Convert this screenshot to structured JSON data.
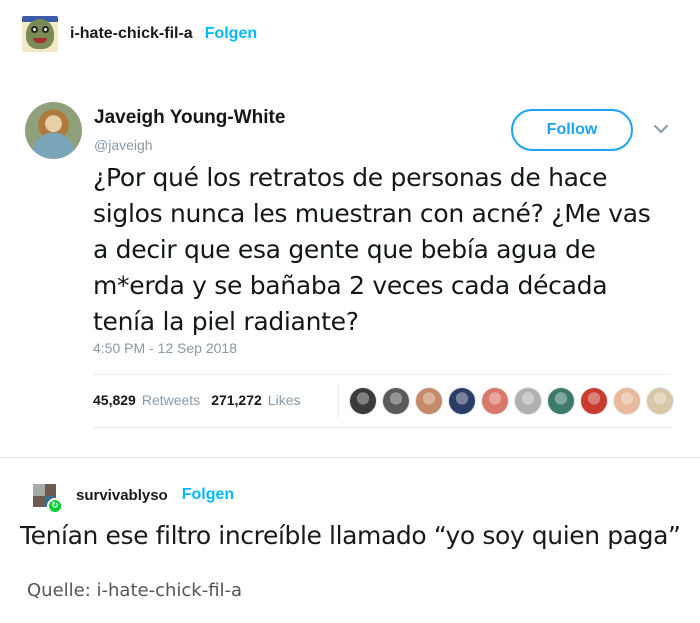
{
  "post": {
    "blog_name": "i-hate-chick-fil-a",
    "follow_label": "Folgen"
  },
  "tweet": {
    "display_name": "Javeigh Young-White",
    "handle": "@javeigh",
    "follow_button": "Follow",
    "text": "¿Por qué los retratos de personas de hace siglos nunca les muestran con acné? ¿Me vas a decir que esa gente que bebía agua de m*erda y se bañaba 2 veces cada década tenía la piel radiante?",
    "timestamp": "4:50 PM - 12 Sep 2018",
    "retweets_count": "45,829",
    "retweets_label": "Retweets",
    "likes_count": "271,272",
    "likes_label": "Likes",
    "liker_avatar_colors": [
      "#3a3a3a",
      "#5a5a5a",
      "#c58a68",
      "#2c3e66",
      "#d9776a",
      "#b0b0b0",
      "#3d7a6a",
      "#c73c2e",
      "#e8b99a",
      "#d8c7a8"
    ]
  },
  "reblog": {
    "blog_name": "survivablyso",
    "follow_label": "Folgen",
    "text": "Tenían ese filtro increíble llamado “yo soy quien paga”"
  },
  "source_line": "Quelle: i-hate-chick-fil-a",
  "colors": {
    "tumblr_link": "#00b8ff",
    "twitter_blue": "#1da1f2",
    "twitter_gray": "#8899a6"
  }
}
